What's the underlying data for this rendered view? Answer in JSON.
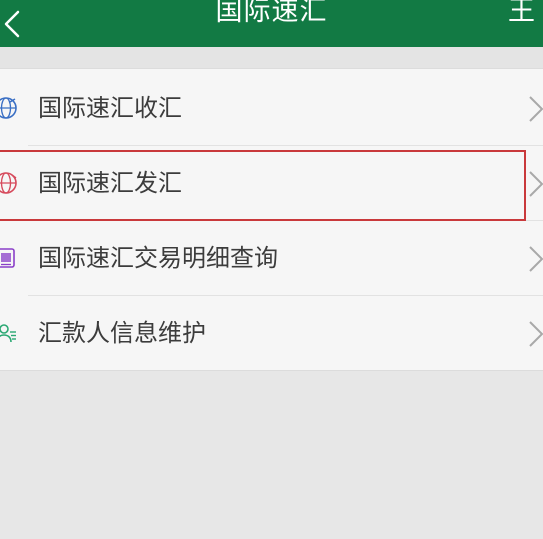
{
  "header": {
    "title": "国际速汇",
    "right_text": "王",
    "background_color": "#127a44",
    "back_icon": "chevron-left-icon"
  },
  "menu": {
    "items": [
      {
        "label": "国际速汇收汇",
        "icon": "globe-icon",
        "icon_color": "#3a6fc4"
      },
      {
        "label": "国际速汇发汇",
        "icon": "globe-send-icon",
        "icon_color": "#d64a5c",
        "highlighted": true
      },
      {
        "label": "国际速汇交易明细查询",
        "icon": "document-icon",
        "icon_color": "#8a3fc8"
      },
      {
        "label": "汇款人信息维护",
        "icon": "person-info-icon",
        "icon_color": "#2aa873"
      }
    ],
    "chevron_icon": "chevron-right-icon",
    "highlight_color": "#c9393b"
  }
}
